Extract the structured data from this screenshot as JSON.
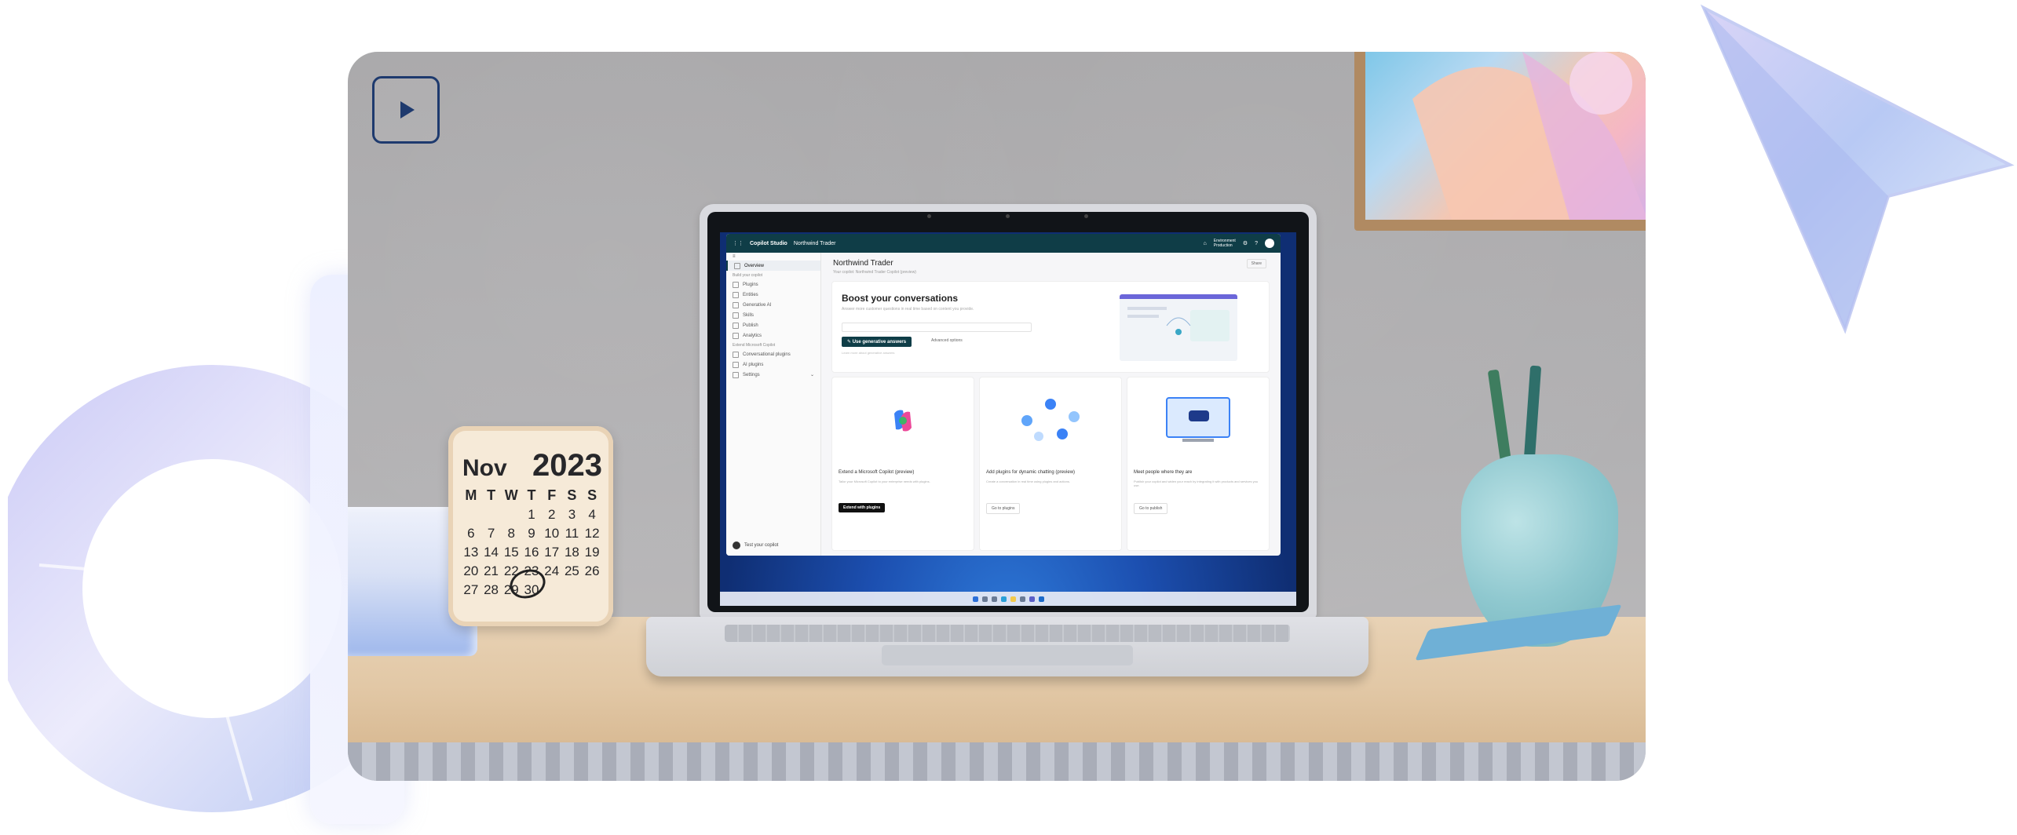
{
  "video": {
    "play_label": "Play video"
  },
  "calendar": {
    "month": "Nov",
    "year": "2023",
    "weekdays": [
      "M",
      "T",
      "W",
      "T",
      "F",
      "S",
      "S"
    ],
    "days": [
      "",
      "",
      "",
      "1",
      "2",
      "3",
      "4",
      "6",
      "7",
      "8",
      "9",
      "10",
      "11",
      "12",
      "13",
      "14",
      "15",
      "16",
      "17",
      "18",
      "19",
      "20",
      "21",
      "22",
      "23",
      "24",
      "25",
      "26",
      "27",
      "28",
      "29",
      "30",
      "",
      "",
      ""
    ]
  },
  "app": {
    "product": "Copilot Studio",
    "workspace": "Northwind Trader",
    "environment_label": "Environment",
    "environment_value": "Production",
    "avatar_initial": "",
    "sidebar": {
      "items_top": [
        {
          "label": "Overview",
          "active": true
        }
      ],
      "section_build": "Build your copilot",
      "items_build": [
        {
          "label": "Plugins"
        },
        {
          "label": "Entities"
        },
        {
          "label": "Generative AI"
        },
        {
          "label": "Skills"
        },
        {
          "label": "Publish"
        },
        {
          "label": "Analytics"
        }
      ],
      "section_extend": "Extend Microsoft Copilot",
      "items_extend": [
        {
          "label": "Conversational plugins"
        },
        {
          "label": "AI plugins"
        },
        {
          "label": "Settings"
        }
      ],
      "footer_label": "Test your copilot"
    },
    "main": {
      "title": "Northwind Trader",
      "subtitle": "Your copilot: Northwind Trader Copilot (preview)",
      "share_label": "Share",
      "boost": {
        "title": "Boost your conversations",
        "description": "Answer more customer questions in real time based on content you provide.",
        "button": "Use generative answers",
        "link": "Advanced options",
        "note": "Learn more about generative answers"
      },
      "tiles": [
        {
          "title": "Extend a Microsoft Copilot (preview)",
          "description": "Tailor your Microsoft Copilot to your enterprise needs with plugins.",
          "button": "Extend with plugins",
          "primary": true
        },
        {
          "title": "Add plugins for dynamic chatting (preview)",
          "description": "Create a conversation in real time using plugins and actions.",
          "button": "Go to plugins",
          "primary": false
        },
        {
          "title": "Meet people where they are",
          "description": "Publish your copilot and widen your reach by integrating it with products and services you use.",
          "button": "Go to publish",
          "primary": false
        }
      ]
    }
  },
  "colors": {
    "app_header": "#0f3d47",
    "play_border": "#1e3a6e",
    "desk": "#e2c8a6",
    "wall": "#b2b1b3"
  }
}
